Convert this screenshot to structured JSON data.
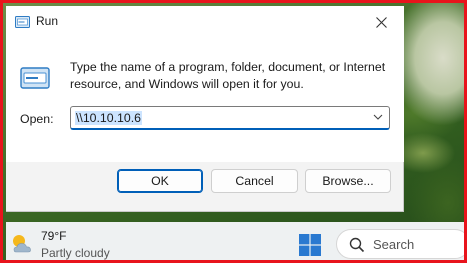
{
  "dialog": {
    "title": "Run",
    "description": "Type the name of a program, folder, document, or Internet resource, and Windows will open it for you.",
    "open_label": "Open:",
    "open_value": "\\\\10.10.10.6",
    "buttons": {
      "ok": "OK",
      "cancel": "Cancel",
      "browse": "Browse..."
    },
    "icons": {
      "app": "run-app-icon",
      "close": "close-icon",
      "dropdown": "chevron-down-icon"
    }
  },
  "taskbar": {
    "weather": {
      "temperature": "79°F",
      "condition": "Partly cloudy",
      "icon": "partly-cloudy-icon"
    },
    "start_icon": "windows-logo-icon",
    "search": {
      "label": "Search",
      "icon": "search-icon"
    }
  },
  "colors": {
    "frame_border": "#e8141c",
    "accent": "#005fb8",
    "selection": "#cce4ff"
  }
}
